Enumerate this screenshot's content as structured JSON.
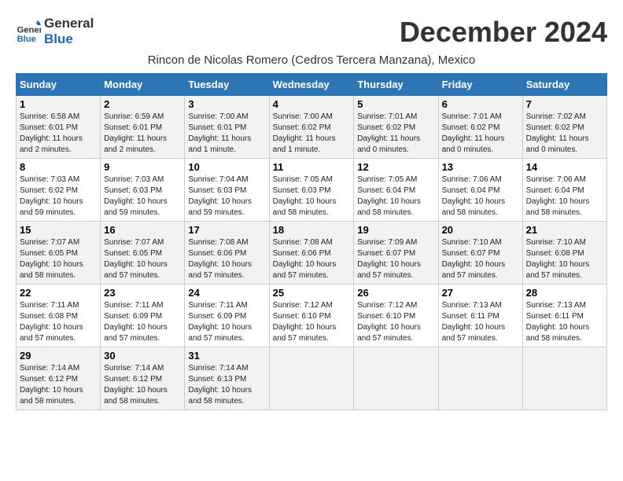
{
  "header": {
    "logo_line1": "General",
    "logo_line2": "Blue",
    "month_title": "December 2024",
    "location": "Rincon de Nicolas Romero (Cedros Tercera Manzana), Mexico"
  },
  "days_of_week": [
    "Sunday",
    "Monday",
    "Tuesday",
    "Wednesday",
    "Thursday",
    "Friday",
    "Saturday"
  ],
  "weeks": [
    [
      {
        "day": 1,
        "sunrise": "6:58 AM",
        "sunset": "6:01 PM",
        "daylight": "11 hours and 2 minutes"
      },
      {
        "day": 2,
        "sunrise": "6:59 AM",
        "sunset": "6:01 PM",
        "daylight": "11 hours and 2 minutes"
      },
      {
        "day": 3,
        "sunrise": "7:00 AM",
        "sunset": "6:01 PM",
        "daylight": "11 hours and 1 minute"
      },
      {
        "day": 4,
        "sunrise": "7:00 AM",
        "sunset": "6:02 PM",
        "daylight": "11 hours and 1 minute"
      },
      {
        "day": 5,
        "sunrise": "7:01 AM",
        "sunset": "6:02 PM",
        "daylight": "11 hours and 0 minutes"
      },
      {
        "day": 6,
        "sunrise": "7:01 AM",
        "sunset": "6:02 PM",
        "daylight": "11 hours and 0 minutes"
      },
      {
        "day": 7,
        "sunrise": "7:02 AM",
        "sunset": "6:02 PM",
        "daylight": "11 hours and 0 minutes"
      }
    ],
    [
      {
        "day": 8,
        "sunrise": "7:03 AM",
        "sunset": "6:02 PM",
        "daylight": "10 hours and 59 minutes"
      },
      {
        "day": 9,
        "sunrise": "7:03 AM",
        "sunset": "6:03 PM",
        "daylight": "10 hours and 59 minutes"
      },
      {
        "day": 10,
        "sunrise": "7:04 AM",
        "sunset": "6:03 PM",
        "daylight": "10 hours and 59 minutes"
      },
      {
        "day": 11,
        "sunrise": "7:05 AM",
        "sunset": "6:03 PM",
        "daylight": "10 hours and 58 minutes"
      },
      {
        "day": 12,
        "sunrise": "7:05 AM",
        "sunset": "6:04 PM",
        "daylight": "10 hours and 58 minutes"
      },
      {
        "day": 13,
        "sunrise": "7:06 AM",
        "sunset": "6:04 PM",
        "daylight": "10 hours and 58 minutes"
      },
      {
        "day": 14,
        "sunrise": "7:06 AM",
        "sunset": "6:04 PM",
        "daylight": "10 hours and 58 minutes"
      }
    ],
    [
      {
        "day": 15,
        "sunrise": "7:07 AM",
        "sunset": "6:05 PM",
        "daylight": "10 hours and 58 minutes"
      },
      {
        "day": 16,
        "sunrise": "7:07 AM",
        "sunset": "6:05 PM",
        "daylight": "10 hours and 57 minutes"
      },
      {
        "day": 17,
        "sunrise": "7:08 AM",
        "sunset": "6:06 PM",
        "daylight": "10 hours and 57 minutes"
      },
      {
        "day": 18,
        "sunrise": "7:08 AM",
        "sunset": "6:06 PM",
        "daylight": "10 hours and 57 minutes"
      },
      {
        "day": 19,
        "sunrise": "7:09 AM",
        "sunset": "6:07 PM",
        "daylight": "10 hours and 57 minutes"
      },
      {
        "day": 20,
        "sunrise": "7:10 AM",
        "sunset": "6:07 PM",
        "daylight": "10 hours and 57 minutes"
      },
      {
        "day": 21,
        "sunrise": "7:10 AM",
        "sunset": "6:08 PM",
        "daylight": "10 hours and 57 minutes"
      }
    ],
    [
      {
        "day": 22,
        "sunrise": "7:11 AM",
        "sunset": "6:08 PM",
        "daylight": "10 hours and 57 minutes"
      },
      {
        "day": 23,
        "sunrise": "7:11 AM",
        "sunset": "6:09 PM",
        "daylight": "10 hours and 57 minutes"
      },
      {
        "day": 24,
        "sunrise": "7:11 AM",
        "sunset": "6:09 PM",
        "daylight": "10 hours and 57 minutes"
      },
      {
        "day": 25,
        "sunrise": "7:12 AM",
        "sunset": "6:10 PM",
        "daylight": "10 hours and 57 minutes"
      },
      {
        "day": 26,
        "sunrise": "7:12 AM",
        "sunset": "6:10 PM",
        "daylight": "10 hours and 57 minutes"
      },
      {
        "day": 27,
        "sunrise": "7:13 AM",
        "sunset": "6:11 PM",
        "daylight": "10 hours and 57 minutes"
      },
      {
        "day": 28,
        "sunrise": "7:13 AM",
        "sunset": "6:11 PM",
        "daylight": "10 hours and 58 minutes"
      }
    ],
    [
      {
        "day": 29,
        "sunrise": "7:14 AM",
        "sunset": "6:12 PM",
        "daylight": "10 hours and 58 minutes"
      },
      {
        "day": 30,
        "sunrise": "7:14 AM",
        "sunset": "6:12 PM",
        "daylight": "10 hours and 58 minutes"
      },
      {
        "day": 31,
        "sunrise": "7:14 AM",
        "sunset": "6:13 PM",
        "daylight": "10 hours and 58 minutes"
      },
      null,
      null,
      null,
      null
    ]
  ]
}
